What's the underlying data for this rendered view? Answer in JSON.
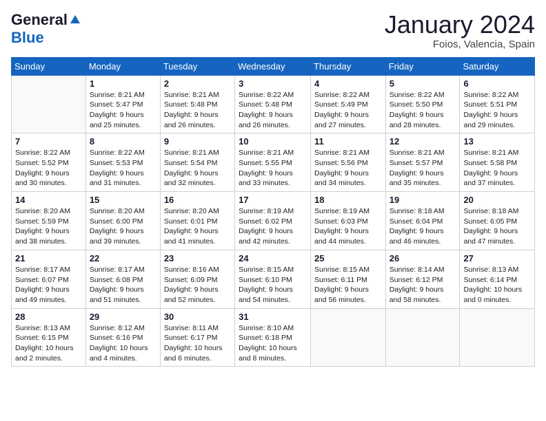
{
  "header": {
    "logo_general": "General",
    "logo_blue": "Blue",
    "month_title": "January 2024",
    "location": "Foios, Valencia, Spain"
  },
  "calendar": {
    "days_of_week": [
      "Sunday",
      "Monday",
      "Tuesday",
      "Wednesday",
      "Thursday",
      "Friday",
      "Saturday"
    ],
    "weeks": [
      [
        {
          "day": "",
          "info": ""
        },
        {
          "day": "1",
          "info": "Sunrise: 8:21 AM\nSunset: 5:47 PM\nDaylight: 9 hours\nand 25 minutes."
        },
        {
          "day": "2",
          "info": "Sunrise: 8:21 AM\nSunset: 5:48 PM\nDaylight: 9 hours\nand 26 minutes."
        },
        {
          "day": "3",
          "info": "Sunrise: 8:22 AM\nSunset: 5:48 PM\nDaylight: 9 hours\nand 26 minutes."
        },
        {
          "day": "4",
          "info": "Sunrise: 8:22 AM\nSunset: 5:49 PM\nDaylight: 9 hours\nand 27 minutes."
        },
        {
          "day": "5",
          "info": "Sunrise: 8:22 AM\nSunset: 5:50 PM\nDaylight: 9 hours\nand 28 minutes."
        },
        {
          "day": "6",
          "info": "Sunrise: 8:22 AM\nSunset: 5:51 PM\nDaylight: 9 hours\nand 29 minutes."
        }
      ],
      [
        {
          "day": "7",
          "info": "Sunrise: 8:22 AM\nSunset: 5:52 PM\nDaylight: 9 hours\nand 30 minutes."
        },
        {
          "day": "8",
          "info": "Sunrise: 8:22 AM\nSunset: 5:53 PM\nDaylight: 9 hours\nand 31 minutes."
        },
        {
          "day": "9",
          "info": "Sunrise: 8:21 AM\nSunset: 5:54 PM\nDaylight: 9 hours\nand 32 minutes."
        },
        {
          "day": "10",
          "info": "Sunrise: 8:21 AM\nSunset: 5:55 PM\nDaylight: 9 hours\nand 33 minutes."
        },
        {
          "day": "11",
          "info": "Sunrise: 8:21 AM\nSunset: 5:56 PM\nDaylight: 9 hours\nand 34 minutes."
        },
        {
          "day": "12",
          "info": "Sunrise: 8:21 AM\nSunset: 5:57 PM\nDaylight: 9 hours\nand 35 minutes."
        },
        {
          "day": "13",
          "info": "Sunrise: 8:21 AM\nSunset: 5:58 PM\nDaylight: 9 hours\nand 37 minutes."
        }
      ],
      [
        {
          "day": "14",
          "info": "Sunrise: 8:20 AM\nSunset: 5:59 PM\nDaylight: 9 hours\nand 38 minutes."
        },
        {
          "day": "15",
          "info": "Sunrise: 8:20 AM\nSunset: 6:00 PM\nDaylight: 9 hours\nand 39 minutes."
        },
        {
          "day": "16",
          "info": "Sunrise: 8:20 AM\nSunset: 6:01 PM\nDaylight: 9 hours\nand 41 minutes."
        },
        {
          "day": "17",
          "info": "Sunrise: 8:19 AM\nSunset: 6:02 PM\nDaylight: 9 hours\nand 42 minutes."
        },
        {
          "day": "18",
          "info": "Sunrise: 8:19 AM\nSunset: 6:03 PM\nDaylight: 9 hours\nand 44 minutes."
        },
        {
          "day": "19",
          "info": "Sunrise: 8:18 AM\nSunset: 6:04 PM\nDaylight: 9 hours\nand 46 minutes."
        },
        {
          "day": "20",
          "info": "Sunrise: 8:18 AM\nSunset: 6:05 PM\nDaylight: 9 hours\nand 47 minutes."
        }
      ],
      [
        {
          "day": "21",
          "info": "Sunrise: 8:17 AM\nSunset: 6:07 PM\nDaylight: 9 hours\nand 49 minutes."
        },
        {
          "day": "22",
          "info": "Sunrise: 8:17 AM\nSunset: 6:08 PM\nDaylight: 9 hours\nand 51 minutes."
        },
        {
          "day": "23",
          "info": "Sunrise: 8:16 AM\nSunset: 6:09 PM\nDaylight: 9 hours\nand 52 minutes."
        },
        {
          "day": "24",
          "info": "Sunrise: 8:15 AM\nSunset: 6:10 PM\nDaylight: 9 hours\nand 54 minutes."
        },
        {
          "day": "25",
          "info": "Sunrise: 8:15 AM\nSunset: 6:11 PM\nDaylight: 9 hours\nand 56 minutes."
        },
        {
          "day": "26",
          "info": "Sunrise: 8:14 AM\nSunset: 6:12 PM\nDaylight: 9 hours\nand 58 minutes."
        },
        {
          "day": "27",
          "info": "Sunrise: 8:13 AM\nSunset: 6:14 PM\nDaylight: 10 hours\nand 0 minutes."
        }
      ],
      [
        {
          "day": "28",
          "info": "Sunrise: 8:13 AM\nSunset: 6:15 PM\nDaylight: 10 hours\nand 2 minutes."
        },
        {
          "day": "29",
          "info": "Sunrise: 8:12 AM\nSunset: 6:16 PM\nDaylight: 10 hours\nand 4 minutes."
        },
        {
          "day": "30",
          "info": "Sunrise: 8:11 AM\nSunset: 6:17 PM\nDaylight: 10 hours\nand 6 minutes."
        },
        {
          "day": "31",
          "info": "Sunrise: 8:10 AM\nSunset: 6:18 PM\nDaylight: 10 hours\nand 8 minutes."
        },
        {
          "day": "",
          "info": ""
        },
        {
          "day": "",
          "info": ""
        },
        {
          "day": "",
          "info": ""
        }
      ]
    ]
  }
}
